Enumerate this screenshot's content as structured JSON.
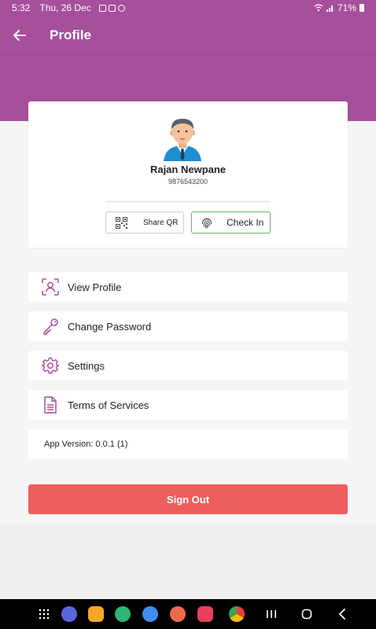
{
  "status_bar": {
    "time": "5:32",
    "date": "Thu, 26 Dec",
    "battery": "71%"
  },
  "header": {
    "title": "Profile",
    "back_icon": "arrow-left-icon"
  },
  "profile": {
    "name": "Rajan Newpane",
    "phone": "9876543200",
    "share_qr_label": "Share QR",
    "check_in_label": "Check In"
  },
  "menu": {
    "items": [
      {
        "label": "View Profile",
        "icon": "user-scan-icon"
      },
      {
        "label": "Change Password",
        "icon": "key-icon"
      },
      {
        "label": "Settings",
        "icon": "gear-icon"
      },
      {
        "label": "Terms of Services",
        "icon": "document-icon"
      }
    ]
  },
  "version_text": "App Version: 0.0.1 (1)",
  "sign_out_label": "Sign Out",
  "colors": {
    "brand": "#a64f9b",
    "sign_out": "#ec5d5e",
    "check_in_border": "#5cb85c"
  }
}
